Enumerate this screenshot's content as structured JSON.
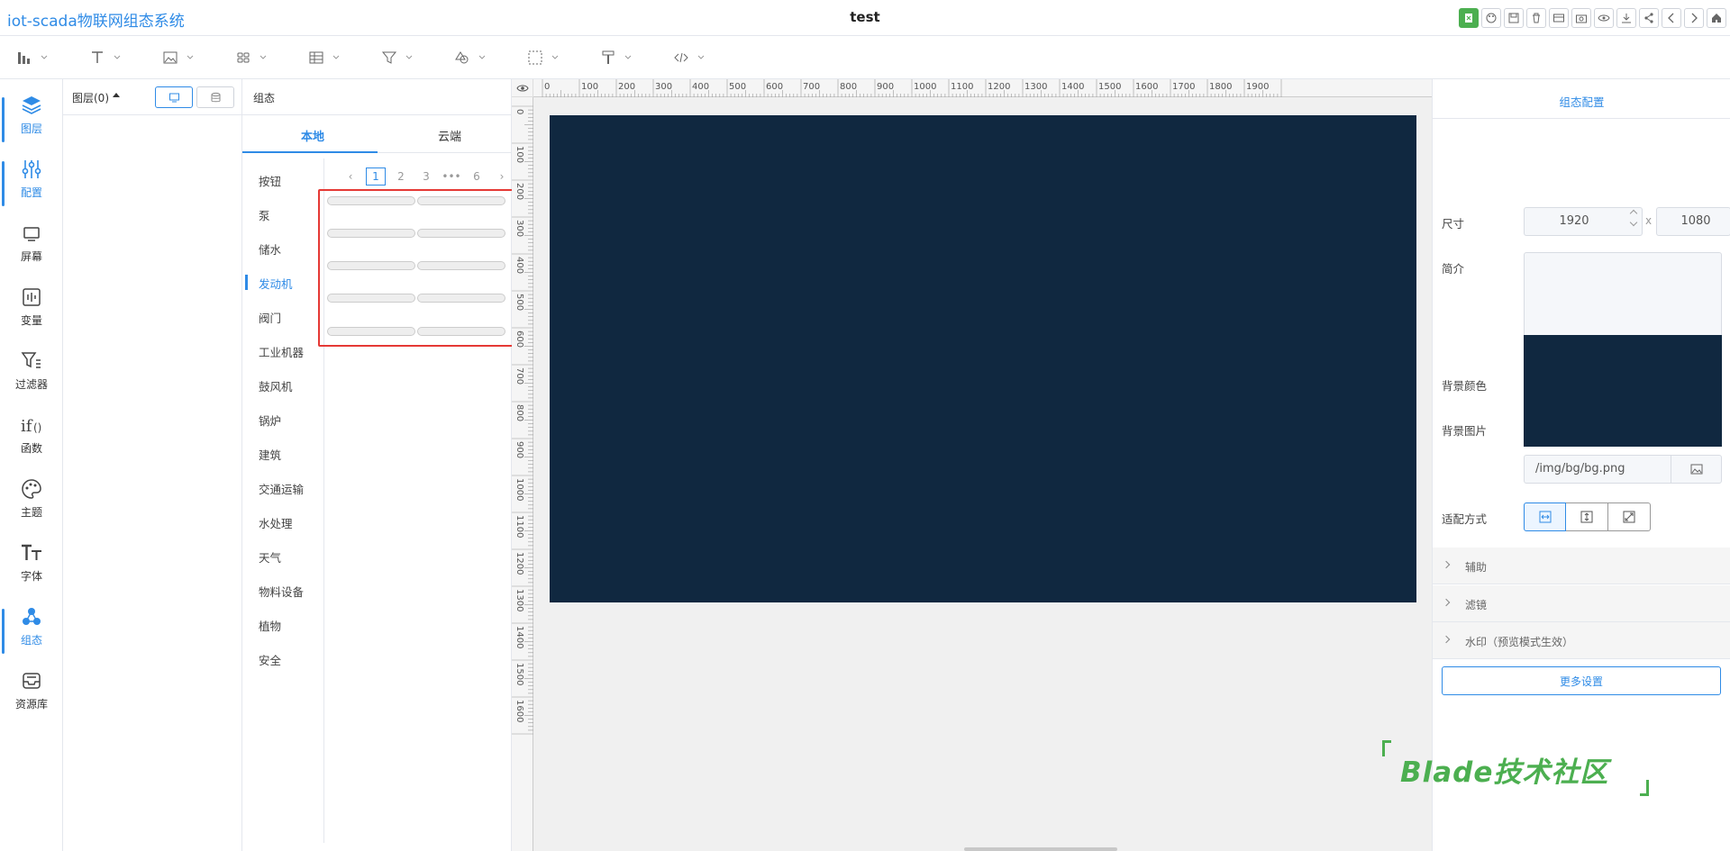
{
  "header": {
    "app_title": "iot-scada物联网组态系统",
    "doc_title": "test",
    "actions": [
      "excel-icon",
      "palette-icon",
      "save-icon",
      "delete-icon",
      "card-icon",
      "camera-icon",
      "preview-icon",
      "download-icon",
      "share-icon",
      "back-icon",
      "forward-icon",
      "home-icon"
    ]
  },
  "toolbar": {
    "tools": [
      "chart-icon",
      "text-icon",
      "image-icon",
      "grid-icon",
      "table-icon",
      "filter-icon",
      "shape-icon",
      "select-icon",
      "format-painter-icon",
      "code-icon"
    ]
  },
  "nav": {
    "items": [
      {
        "label": "图层",
        "icon": "layers-icon"
      },
      {
        "label": "配置",
        "icon": "sliders-icon"
      },
      {
        "label": "屏幕",
        "icon": "screen-icon"
      },
      {
        "label": "变量",
        "icon": "variable-icon"
      },
      {
        "label": "过滤器",
        "icon": "filter-icon"
      },
      {
        "label": "函数",
        "icon": "function-icon"
      },
      {
        "label": "主题",
        "icon": "palette-icon"
      },
      {
        "label": "字体",
        "icon": "font-icon"
      },
      {
        "label": "组态",
        "icon": "components-icon"
      },
      {
        "label": "资源库",
        "icon": "inbox-icon"
      }
    ],
    "active": [
      0,
      1,
      8
    ]
  },
  "layers": {
    "title": "图层(0)"
  },
  "components": {
    "title": "组态",
    "tabs": [
      "本地",
      "云端"
    ],
    "categories": [
      "按钮",
      "泵",
      "储水",
      "发动机",
      "阀门",
      "工业机器",
      "鼓风机",
      "锅炉",
      "建筑",
      "交通运输",
      "水处理",
      "天气",
      "物料设备",
      "植物",
      "安全"
    ],
    "active_category": "发动机",
    "pager": {
      "pages": [
        "1",
        "2",
        "3",
        "•••",
        "6"
      ],
      "current": "1"
    }
  },
  "rulers": {
    "h_labels": [
      "0",
      "100",
      "200",
      "300",
      "400",
      "500",
      "600",
      "700",
      "800",
      "900",
      "1000",
      "1100",
      "1200",
      "1300",
      "1400",
      "1500",
      "1600",
      "1700",
      "1800",
      "1900"
    ],
    "v_labels": [
      "0",
      "100",
      "200",
      "300",
      "400",
      "500",
      "600",
      "700",
      "800",
      "900",
      "1000",
      "1100",
      "1200",
      "1300",
      "1400",
      "1500",
      "1600"
    ]
  },
  "config": {
    "title": "组态配置",
    "size_label": "尺寸",
    "width": "1920",
    "height": "1080",
    "x_char": "x",
    "intro_label": "简介",
    "bg_color_label": "背景颜色",
    "bg_image_label": "背景图片",
    "bg_image_path": "/img/bg/bg.png",
    "canvas_color": "#102840",
    "fit_label": "适配方式",
    "sections": [
      "辅助",
      "滤镜",
      "水印（预览模式生效）"
    ],
    "more_button": "更多设置"
  },
  "watermark": {
    "text": "Blade技术社区"
  }
}
